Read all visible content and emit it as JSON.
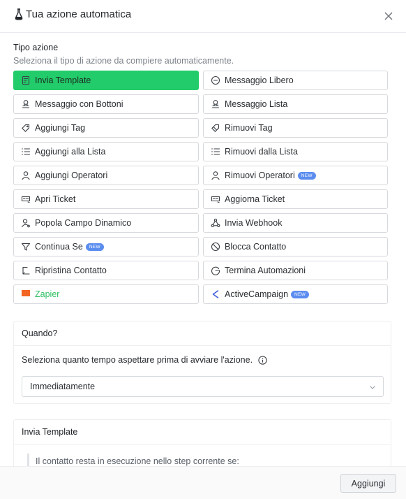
{
  "header": {
    "title": "Tua azione automatica",
    "title_icon": "flask-icon",
    "close_icon": "close-icon"
  },
  "tipo_azione": {
    "label": "Tipo azione",
    "help": "Seleziona il tipo di azione da compiere automaticamente.",
    "actions": [
      {
        "label": "Invia Template",
        "icon": "template-icon",
        "active": true
      },
      {
        "label": "Messaggio Libero",
        "icon": "chat-bubble-icon"
      },
      {
        "label": "Messaggio con Bottoni",
        "icon": "stamp-icon"
      },
      {
        "label": "Messaggio Lista",
        "icon": "stamp-icon"
      },
      {
        "label": "Aggiungi Tag",
        "icon": "tag-icon"
      },
      {
        "label": "Rimuovi Tag",
        "icon": "tag-remove-icon"
      },
      {
        "label": "Aggiungi alla Lista",
        "icon": "list-icon"
      },
      {
        "label": "Rimuovi dalla Lista",
        "icon": "list-icon"
      },
      {
        "label": "Aggiungi Operatori",
        "icon": "user-icon"
      },
      {
        "label": "Rimuovi Operatori",
        "icon": "user-icon",
        "badge": "NEW"
      },
      {
        "label": "Apri Ticket",
        "icon": "ticket-icon"
      },
      {
        "label": "Aggiorna Ticket",
        "icon": "ticket-icon"
      },
      {
        "label": "Popola Campo Dinamico",
        "icon": "user-field-icon"
      },
      {
        "label": "Invia Webhook",
        "icon": "webhook-icon"
      },
      {
        "label": "Continua Se",
        "icon": "filter-icon",
        "badge": "NEW"
      },
      {
        "label": "Blocca Contatto",
        "icon": "block-icon"
      },
      {
        "label": "Ripristina Contatto",
        "icon": "undo-icon"
      },
      {
        "label": "Termina Automazioni",
        "icon": "stop-circle-icon"
      },
      {
        "label": "Zapier",
        "icon": "zapier-icon"
      },
      {
        "label": "ActiveCampaign",
        "icon": "chevron-left-icon",
        "badge": "NEW"
      }
    ]
  },
  "quando": {
    "title": "Quando?",
    "description": "Seleziona quanto tempo aspettare prima di avviare l'azione.",
    "select_value": "Immediatamente"
  },
  "invia_template": {
    "title": "Invia Template",
    "note": "Il contatto resta in esecuzione nello step corrente se:"
  },
  "footer": {
    "add_label": "Aggiungi"
  },
  "colors": {
    "accent": "#22cc6a",
    "badge": "#5b8def",
    "zapier": "#f26522"
  }
}
